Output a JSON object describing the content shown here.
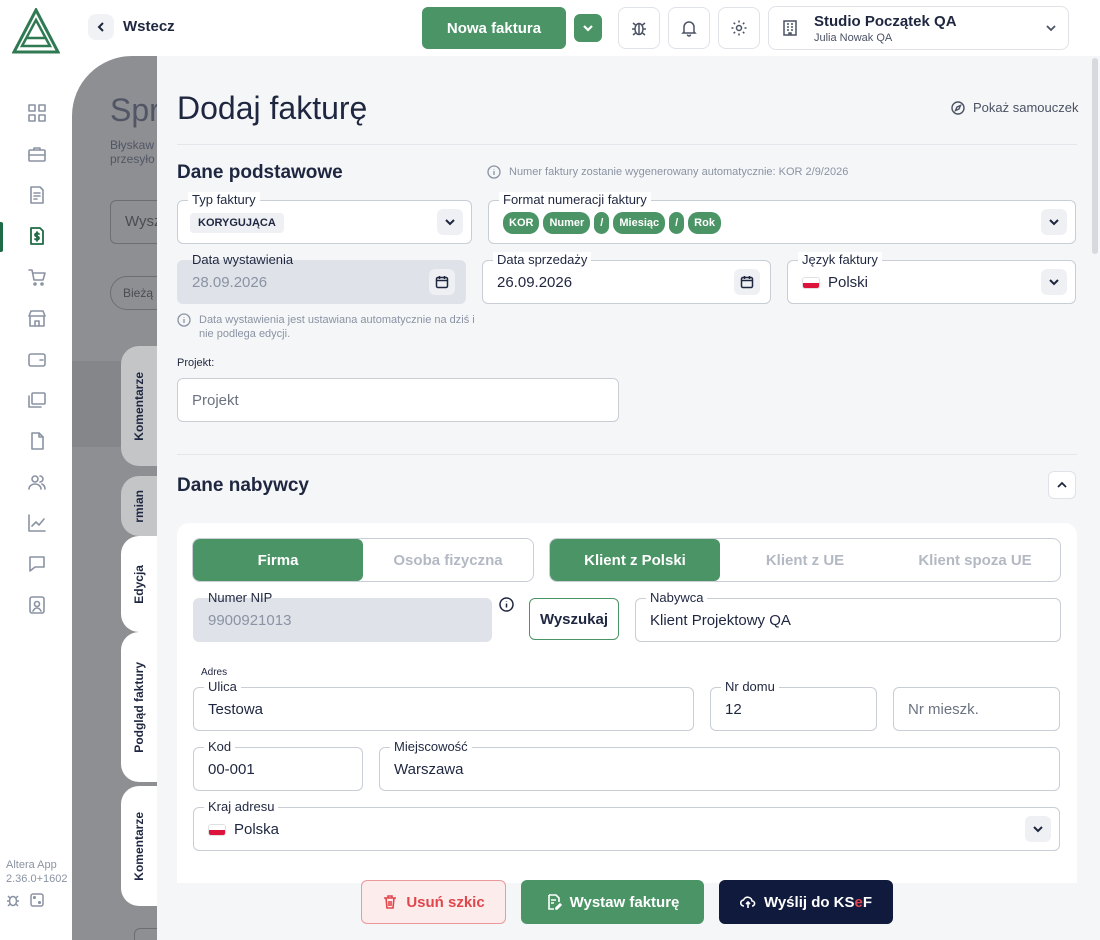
{
  "app": {
    "name": "Altera App",
    "version": "2.36.0+1602"
  },
  "topbar": {
    "back_label": "Wstecz",
    "new_invoice_label": "Nowa faktura",
    "company_name": "Studio Początek QA",
    "company_user": "Julia Nowak QA"
  },
  "background_page": {
    "title_fragment": "Spr",
    "subtitle_fragment": "Błyskaw przesyło",
    "search_fragment": "Wysz",
    "filter_fragment": "Bieżą"
  },
  "side_tabs": [
    "Komentarze",
    "rmian",
    "Edycja",
    "Podgląd faktury",
    "Komentarze"
  ],
  "form": {
    "title": "Dodaj fakturę",
    "tutorial_label": "Pokaż samouczek",
    "basic": {
      "heading": "Dane podstawowe",
      "auto_number_info": "Numer faktury zostanie wygenerowany automatycznie: KOR 2/9/2026",
      "invoice_type_label": "Typ faktury",
      "invoice_type_value": "KORYGUJĄCA",
      "numbering_label": "Format numeracji faktury",
      "numbering_tokens": [
        "KOR",
        "Numer",
        "/",
        "Miesiąc",
        "/",
        "Rok"
      ],
      "issue_date_label": "Data wystawienia",
      "issue_date_value": "28.09.2026",
      "issue_date_info": "Data wystawienia jest ustawiana automatycznie na dziś i nie podlega edycji.",
      "sale_date_label": "Data sprzedaży",
      "sale_date_value": "26.09.2026",
      "language_label": "Język faktury",
      "language_value": "Polski",
      "project_label": "Projekt:",
      "project_placeholder": "Projekt"
    },
    "buyer": {
      "heading": "Dane nabywcy",
      "entity_options": [
        "Firma",
        "Osoba fizyczna"
      ],
      "entity_selected": "Firma",
      "client_options": [
        "Klient z Polski",
        "Klient z UE",
        "Klient spoza UE"
      ],
      "client_selected": "Klient z Polski",
      "nip_label": "Numer NIP",
      "nip_value": "9900921013",
      "search_label": "Wyszukaj",
      "buyer_label": "Nabywca",
      "buyer_value": "Klient Projektowy QA",
      "address_label": "Adres",
      "street_label": "Ulica",
      "street_value": "Testowa",
      "house_label": "Nr domu",
      "house_value": "12",
      "flat_placeholder": "Nr mieszk.",
      "postcode_label": "Kod",
      "postcode_value": "00-001",
      "city_label": "Miejscowość",
      "city_value": "Warszawa",
      "country_label": "Kraj adresu",
      "country_value": "Polska"
    }
  },
  "footer": {
    "delete_label": "Usuń szkic",
    "issue_label": "Wystaw fakturę",
    "send_label_prefix": "Wyślij do KS",
    "send_label_e": "e",
    "send_label_suffix": "F"
  },
  "colors": {
    "primary_green": "#4b9466",
    "dark_navy": "#0f1a3d",
    "danger_red": "#e0474c",
    "danger_bg": "#fdecec"
  }
}
